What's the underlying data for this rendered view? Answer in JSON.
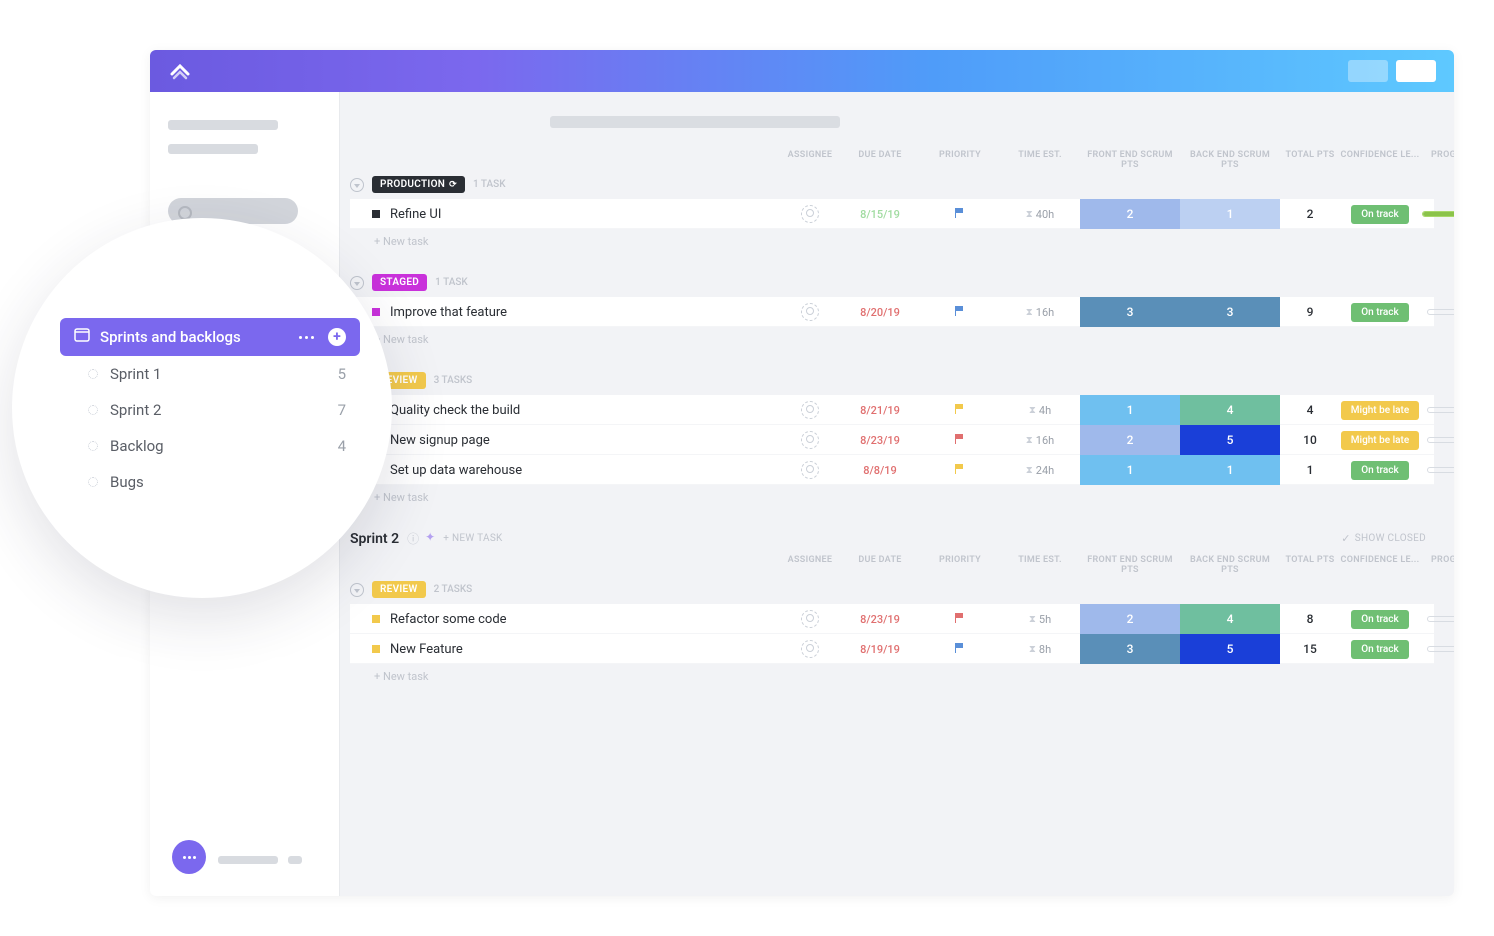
{
  "columns": {
    "assignee": "ASSIGNEE",
    "due_date": "DUE DATE",
    "priority": "PRIORITY",
    "time_est": "TIME EST.",
    "front_pts": "FRONT END SCRUM PTS",
    "back_pts": "BACK END SCRUM PTS",
    "total_pts": "TOTAL PTS",
    "confidence": "CONFIDENCE LE...",
    "progress": "PROGRESS"
  },
  "confidence": {
    "on_track": "On track",
    "might_late": "Might be late"
  },
  "groups": [
    {
      "name": "PRODUCTION",
      "badge_class": "prod",
      "count_label": "1 TASK",
      "tasks": [
        {
          "name": "Refine UI",
          "square_color": "#2a2e34",
          "due": "8/15/19",
          "due_color": "#a0dba0",
          "priority_color": "#5a8fd8",
          "time": "40h",
          "front": {
            "v": "2",
            "bg": "#9fb9eb"
          },
          "back": {
            "v": "1",
            "bg": "#bcd0f2"
          },
          "total": "2",
          "conf": "on_track",
          "conf_bg": "#6fbf73",
          "prog_pct": "100%",
          "prog_fill": 100,
          "prog_border": "#a8d86a"
        }
      ]
    },
    {
      "name": "STAGED",
      "badge_class": "staged",
      "count_label": "1 TASK",
      "tasks": [
        {
          "name": "Improve that feature",
          "square_color": "#c931db",
          "due": "8/20/19",
          "due_color": "#e06f6f",
          "priority_color": "#5a8fd8",
          "time": "16h",
          "front": {
            "v": "3",
            "bg": "#5a8fb8"
          },
          "back": {
            "v": "3",
            "bg": "#5a8fb8"
          },
          "total": "9",
          "conf": "on_track",
          "conf_bg": "#6fbf73",
          "prog_pct": "0%",
          "prog_fill": 0
        }
      ]
    },
    {
      "name": "REVIEW",
      "badge_class": "review",
      "count_label": "3 TASKS",
      "tasks": [
        {
          "name": "Quality check the build",
          "square_color": "#f2c94c",
          "due": "8/21/19",
          "due_color": "#e06f6f",
          "priority_color": "#f2c94c",
          "time": "4h",
          "front": {
            "v": "1",
            "bg": "#6fc0f0"
          },
          "back": {
            "v": "4",
            "bg": "#6fbf9f"
          },
          "total": "4",
          "conf": "might_late",
          "conf_bg": "#f2c94c",
          "prog_pct": "0%",
          "prog_fill": 0
        },
        {
          "name": "New signup page",
          "square_color": "#f2c94c",
          "due": "8/23/19",
          "due_color": "#e06f6f",
          "priority_color": "#e06f6f",
          "time": "16h",
          "front": {
            "v": "2",
            "bg": "#9fb9eb"
          },
          "back": {
            "v": "5",
            "bg": "#1a3fd8"
          },
          "total": "10",
          "conf": "might_late",
          "conf_bg": "#f2c94c",
          "prog_pct": "0%",
          "prog_fill": 0
        },
        {
          "name": "Set up data warehouse",
          "square_color": "#f2c94c",
          "due": "8/8/19",
          "due_color": "#e06f6f",
          "priority_color": "#f2c94c",
          "time": "24h",
          "front": {
            "v": "1",
            "bg": "#6fc0f0"
          },
          "back": {
            "v": "1",
            "bg": "#6fc0f0"
          },
          "total": "1",
          "conf": "on_track",
          "conf_bg": "#6fbf73",
          "prog_pct": "0%",
          "prog_fill": 0
        }
      ]
    }
  ],
  "sprint2": {
    "title": "Sprint 2",
    "new_task_label": "+ NEW TASK",
    "show_closed": "SHOW CLOSED",
    "group": {
      "name": "REVIEW",
      "badge_class": "review",
      "count_label": "2 TASKS",
      "tasks": [
        {
          "name": "Refactor some code",
          "square_color": "#f2c94c",
          "due": "8/23/19",
          "due_color": "#e06f6f",
          "priority_color": "#e06f6f",
          "time": "5h",
          "front": {
            "v": "2",
            "bg": "#9fb9eb"
          },
          "back": {
            "v": "4",
            "bg": "#6fbf9f"
          },
          "total": "8",
          "conf": "on_track",
          "conf_bg": "#6fbf73",
          "prog_pct": "0%",
          "prog_fill": 0
        },
        {
          "name": "New Feature",
          "square_color": "#f2c94c",
          "due": "8/19/19",
          "due_color": "#e06f6f",
          "priority_color": "#5a8fd8",
          "time": "8h",
          "front": {
            "v": "3",
            "bg": "#5a8fb8"
          },
          "back": {
            "v": "5",
            "bg": "#1a3fd8"
          },
          "total": "15",
          "conf": "on_track",
          "conf_bg": "#6fbf73",
          "prog_pct": "0%",
          "prog_fill": 0
        }
      ]
    }
  },
  "new_task": "+ New task",
  "zoom": {
    "folder": "Sprints and backlogs",
    "items": [
      {
        "label": "Sprint 1",
        "count": "5"
      },
      {
        "label": "Sprint 2",
        "count": "7"
      },
      {
        "label": "Backlog",
        "count": "4"
      },
      {
        "label": "Bugs",
        "count": ""
      }
    ]
  }
}
